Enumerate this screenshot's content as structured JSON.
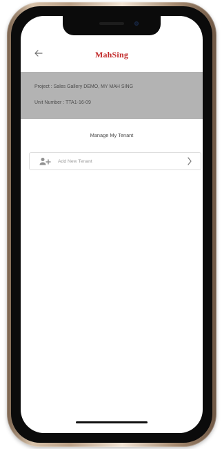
{
  "header": {
    "brand_logo": "MahSing"
  },
  "project": {
    "label": "Project :",
    "value": "Sales Gallery DEMO, MY MAH SING",
    "unit_label": "Unit Number :",
    "unit_value": "TTA1-16-09"
  },
  "section": {
    "title": "Manage My Tenant"
  },
  "tenant_action": {
    "label": "Add New Tenant",
    "icon": "add-user-icon",
    "trailing_icon": "chevron-right-icon"
  },
  "icons": {
    "back": "back-arrow-icon"
  },
  "colors": {
    "brand": "#c22b2b",
    "banner": "#b3b3b3",
    "frame_gold": "#d7c2aa"
  }
}
